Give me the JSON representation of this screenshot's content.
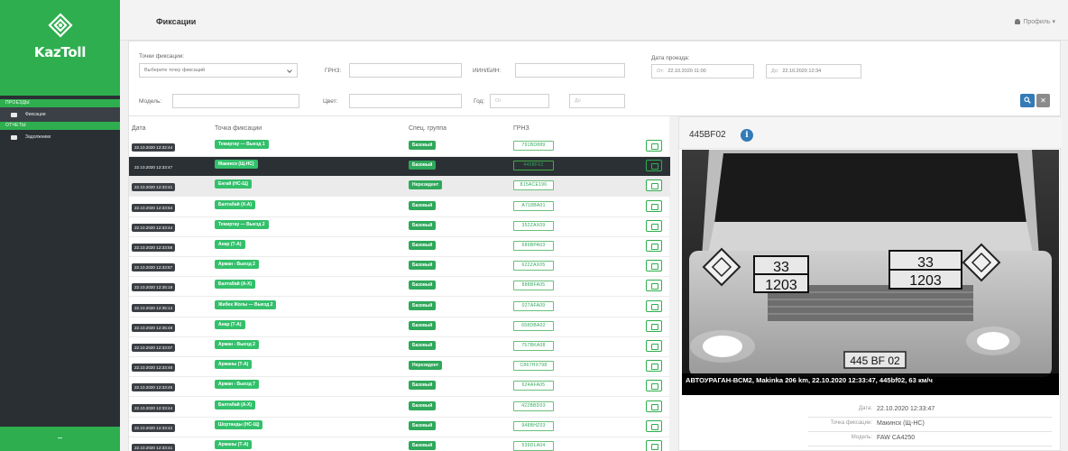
{
  "app": {
    "brand": "KazToll",
    "page_title": "Фиксации",
    "profile_label": "Профиль ▾",
    "footer_glyph": "−"
  },
  "sidebar": {
    "sections": [
      {
        "label": "ПРОЕЗДЫ",
        "items": [
          {
            "label": "Фиксации",
            "icon": "truck-icon",
            "active": true
          }
        ]
      },
      {
        "label": "ОТЧЕТЫ",
        "items": [
          {
            "label": "Задолжники",
            "icon": "list-icon",
            "active": false
          }
        ]
      }
    ]
  },
  "filters": {
    "point_label": "Точки фиксации:",
    "point_placeholder": "Выберите точку фиксаций",
    "grnz_label": "ГРНЗ:",
    "iin_label": "ИИН/БИН:",
    "date_label": "Дата проезда:",
    "from_label": "От:",
    "from_value": "22.10.2020 11:00",
    "to_label": "До:",
    "to_value": "22.10.2020 12:34",
    "model_label": "Модель:",
    "color_label": "Цвет:",
    "year_label": "Год:",
    "year_from_ph": "От",
    "year_to_ph": "До",
    "search_glyph": "🔍",
    "clear_glyph": "✕"
  },
  "table": {
    "headers": {
      "date": "Дата",
      "point": "Точка фиксации",
      "group": "Спец. группа",
      "grnz": "ГРНЗ"
    },
    "rows": [
      {
        "date": "22.10.2020 12:32:44",
        "point": "Темиртау — Выезд 1",
        "group": "Базовый",
        "grnz": "791BD889",
        "state": ""
      },
      {
        "date": "22.10.2020 12:33:47",
        "point": "Макинск (Щ-НС)",
        "group": "Базовый",
        "grnz": "445BF02",
        "state": "sel"
      },
      {
        "date": "22.10.2020 12:33:41",
        "point": "Енгай (НС-Щ)",
        "group": "Нерезидент",
        "grnz": "815ACE196",
        "state": "hl"
      },
      {
        "date": "22.10.2020 12:33:54",
        "point": "Балтабай (Х-А)",
        "group": "Базовый",
        "grnz": "A718BA01",
        "state": ""
      },
      {
        "date": "22.10.2020 12:33:44",
        "point": "Темиртау — Выезд 2",
        "group": "Базовый",
        "grnz": "352ZAX09",
        "state": ""
      },
      {
        "date": "22.10.2020 12:33:58",
        "point": "Анар (Т-А)",
        "group": "Базовый",
        "grnz": "686BPA03",
        "state": ""
      },
      {
        "date": "22.10.2020 12:33:57",
        "point": "Арман - Выезд 2",
        "group": "Базовый",
        "grnz": "622ZAX05",
        "state": ""
      },
      {
        "date": "22.10.2020 12:35:18",
        "point": "Балтабай (А-Х)",
        "group": "Базовый",
        "grnz": "888BFA05",
        "state": ""
      },
      {
        "date": "22.10.2020 12:35:14",
        "point": "Жибек Жолы — Выезд 2",
        "group": "Базовый",
        "grnz": "027AFA09",
        "state": ""
      },
      {
        "date": "22.10.2020 12:35:48",
        "point": "Анар (Т-А)",
        "group": "Базовый",
        "grnz": "658DBA02",
        "state": ""
      },
      {
        "date": "22.10.2020 12:33:07",
        "point": "Арман - Выезд 2",
        "group": "Базовый",
        "grnz": "757BKA08",
        "state": ""
      },
      {
        "date": "22.10.2020 12:33:46",
        "point": "Арманы (Т-А)",
        "group": "Нерезидент",
        "grnz": "C867HX798",
        "state": ""
      },
      {
        "date": "22.10.2020 12:33:45",
        "point": "Арман - Выезд 7",
        "group": "Базовый",
        "grnz": "624AFA05",
        "state": ""
      },
      {
        "date": "22.10.2020 12:33:44",
        "point": "Балтабай (А-Х)",
        "group": "Базовый",
        "grnz": "422BBD03",
        "state": ""
      },
      {
        "date": "22.10.2020 12:33:42",
        "point": "Шортанды (НС-Щ)",
        "group": "Базовый",
        "grnz": "948BHZ03",
        "state": ""
      },
      {
        "date": "22.10.2020 12:33:41",
        "point": "Арманы (Т-А)",
        "group": "Базовый",
        "grnz": "539DLA04",
        "state": ""
      }
    ]
  },
  "detail": {
    "plate": "445BF02",
    "caption": "АВТОУРАГАН-ВСМ2, Makinka 206 km, 22.10.2020 12:33:47, 445bf02, 63 км/ч",
    "hazard_top_left": "33",
    "hazard_bottom_left": "1203",
    "hazard_top_right": "33",
    "hazard_bottom_right": "1203",
    "truck_plate": "445 BF 02",
    "fields": [
      {
        "key": "Дата:",
        "value": "22.10.2020 12:33:47"
      },
      {
        "key": "Точка фиксации:",
        "value": "Макинск (Щ-НС)"
      },
      {
        "key": "Модель:",
        "value": "FAW CA4250"
      }
    ]
  },
  "colors": {
    "accent": "#2eae4e",
    "sidebar": "#2a2f34",
    "badge_green": "#33c06b",
    "primary_blue": "#337ab7"
  }
}
